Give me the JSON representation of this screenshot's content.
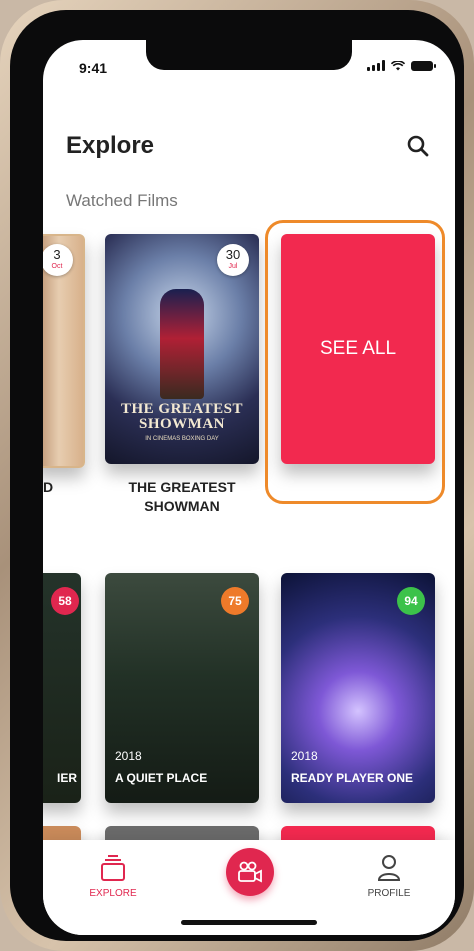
{
  "status": {
    "time": "9:41"
  },
  "header": {
    "title": "Explore"
  },
  "section": {
    "title": "Watched Films"
  },
  "watched": {
    "left_partial": {
      "day": "3",
      "month": "Oct",
      "title_fragment": "D"
    },
    "featured": {
      "title": "THE GREATEST SHOWMAN",
      "day": "30",
      "month": "Jul",
      "poster_title": "THE GREATEST SHOWMAN",
      "poster_subtitle": "IN CINEMAS BOXING DAY"
    },
    "see_all_label": "SEE ALL"
  },
  "films": [
    {
      "score": "58",
      "score_color": "#e0274f",
      "title_fragment": "IER"
    },
    {
      "score": "75",
      "score_color": "#ee7a2a",
      "year": "2018",
      "title": "A QUIET PLACE"
    },
    {
      "score": "94",
      "score_color": "#3cc24a",
      "year": "2018",
      "title": "READY PLAYER ONE"
    }
  ],
  "tabs": {
    "explore": "EXPLORE",
    "profile": "PROFILE"
  },
  "colors": {
    "accent": "#e0274f",
    "highlight": "#ee8a2a"
  }
}
